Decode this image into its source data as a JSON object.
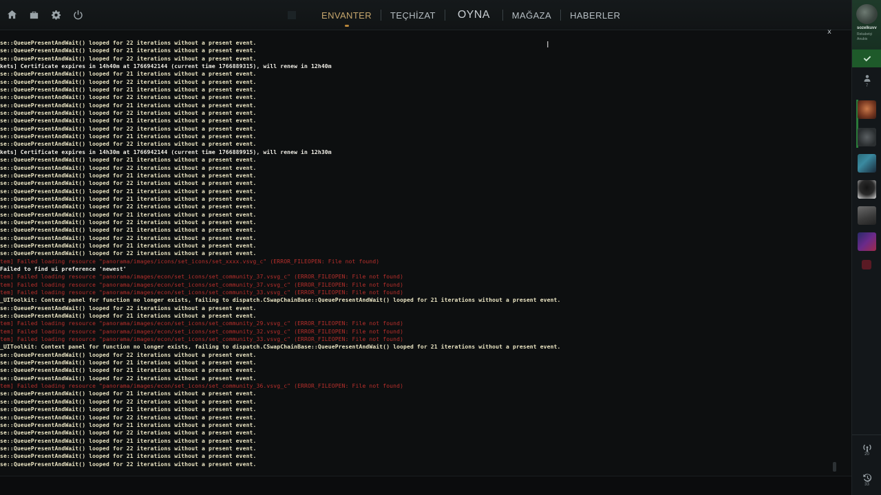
{
  "nav": {
    "items": [
      {
        "label": "ENVANTER",
        "active": true
      },
      {
        "label": "TEÇHİZAT",
        "active": false
      },
      {
        "label": "OYNA",
        "active": false
      },
      {
        "label": "MAĞAZA",
        "active": false
      },
      {
        "label": "HABERLER",
        "active": false
      }
    ]
  },
  "system_icons": [
    "home-icon",
    "briefcase-icon",
    "gear-icon",
    "power-icon"
  ],
  "console": {
    "close_label": "x",
    "lines": [
      {
        "text": "se::QueuePresentAndWait() looped for 22 iterations without a present event.",
        "kind": "warn"
      },
      {
        "text": "se::QueuePresentAndWait() looped for 21 iterations without a present event.",
        "kind": "warn"
      },
      {
        "text": "se::QueuePresentAndWait() looped for 22 iterations without a present event.",
        "kind": "warn"
      },
      {
        "text": "kets] Certificate expires in 14h40m at 1766942144 (current time 1766889315), will renew in 12h40m",
        "kind": "info"
      },
      {
        "text": "se::QueuePresentAndWait() looped for 21 iterations without a present event.",
        "kind": "warn"
      },
      {
        "text": "se::QueuePresentAndWait() looped for 22 iterations without a present event.",
        "kind": "warn"
      },
      {
        "text": "se::QueuePresentAndWait() looped for 21 iterations without a present event.",
        "kind": "warn"
      },
      {
        "text": "se::QueuePresentAndWait() looped for 22 iterations without a present event.",
        "kind": "warn"
      },
      {
        "text": "se::QueuePresentAndWait() looped for 21 iterations without a present event.",
        "kind": "warn"
      },
      {
        "text": "se::QueuePresentAndWait() looped for 22 iterations without a present event.",
        "kind": "warn"
      },
      {
        "text": "se::QueuePresentAndWait() looped for 21 iterations without a present event.",
        "kind": "warn"
      },
      {
        "text": "se::QueuePresentAndWait() looped for 22 iterations without a present event.",
        "kind": "warn"
      },
      {
        "text": "se::QueuePresentAndWait() looped for 21 iterations without a present event.",
        "kind": "warn"
      },
      {
        "text": "se::QueuePresentAndWait() looped for 22 iterations without a present event.",
        "kind": "warn"
      },
      {
        "text": "kets] Certificate expires in 14h30m at 1766942144 (current time 1766889915), will renew in 12h30m",
        "kind": "info"
      },
      {
        "text": "se::QueuePresentAndWait() looped for 21 iterations without a present event.",
        "kind": "warn"
      },
      {
        "text": "se::QueuePresentAndWait() looped for 22 iterations without a present event.",
        "kind": "warn"
      },
      {
        "text": "se::QueuePresentAndWait() looped for 21 iterations without a present event.",
        "kind": "warn"
      },
      {
        "text": "se::QueuePresentAndWait() looped for 22 iterations without a present event.",
        "kind": "warn"
      },
      {
        "text": "se::QueuePresentAndWait() looped for 21 iterations without a present event.",
        "kind": "warn"
      },
      {
        "text": "se::QueuePresentAndWait() looped for 21 iterations without a present event.",
        "kind": "warn"
      },
      {
        "text": "se::QueuePresentAndWait() looped for 22 iterations without a present event.",
        "kind": "warn"
      },
      {
        "text": "se::QueuePresentAndWait() looped for 21 iterations without a present event.",
        "kind": "warn"
      },
      {
        "text": "se::QueuePresentAndWait() looped for 22 iterations without a present event.",
        "kind": "warn"
      },
      {
        "text": "se::QueuePresentAndWait() looped for 21 iterations without a present event.",
        "kind": "warn"
      },
      {
        "text": "se::QueuePresentAndWait() looped for 22 iterations without a present event.",
        "kind": "warn"
      },
      {
        "text": "se::QueuePresentAndWait() looped for 21 iterations without a present event.",
        "kind": "warn"
      },
      {
        "text": "se::QueuePresentAndWait() looped for 22 iterations without a present event.",
        "kind": "warn"
      },
      {
        "text": "tem] Failed loading resource \"panorama/images/icons/set_icons/set_xxxx.vsvg_c\" (ERROR_FILEOPEN: File not found)",
        "kind": "error"
      },
      {
        "text": "Failed to find ui preference 'newest'",
        "kind": "info"
      },
      {
        "text": "tem] Failed loading resource \"panorama/images/econ/set_icons/set_community_37.vsvg_c\" (ERROR_FILEOPEN: File not found)",
        "kind": "error"
      },
      {
        "text": "tem] Failed loading resource \"panorama/images/econ/set_icons/set_community_37.vsvg_c\" (ERROR_FILEOPEN: File not found)",
        "kind": "error"
      },
      {
        "text": "tem] Failed loading resource \"panorama/images/econ/set_icons/set_community_33.vsvg_c\" (ERROR_FILEOPEN: File not found)",
        "kind": "error"
      },
      {
        "text": "_UIToolkit: Context panel for function no longer exists, failing to dispatch.CSwapChainBase::QueuePresentAndWait() looped for 21 iterations without a present event.",
        "kind": "warn"
      },
      {
        "text": "se::QueuePresentAndWait() looped for 22 iterations without a present event.",
        "kind": "warn"
      },
      {
        "text": "se::QueuePresentAndWait() looped for 21 iterations without a present event.",
        "kind": "warn"
      },
      {
        "text": "tem] Failed loading resource \"panorama/images/econ/set_icons/set_community_29.vsvg_c\" (ERROR_FILEOPEN: File not found)",
        "kind": "error"
      },
      {
        "text": "tem] Failed loading resource \"panorama/images/econ/set_icons/set_community_32.vsvg_c\" (ERROR_FILEOPEN: File not found)",
        "kind": "error"
      },
      {
        "text": "tem] Failed loading resource \"panorama/images/econ/set_icons/set_community_33.vsvg_c\" (ERROR_FILEOPEN: File not found)",
        "kind": "error"
      },
      {
        "text": "_UIToolkit: Context panel for function no longer exists, failing to dispatch.CSwapChainBase::QueuePresentAndWait() looped for 21 iterations without a present event.",
        "kind": "warn"
      },
      {
        "text": "se::QueuePresentAndWait() looped for 22 iterations without a present event.",
        "kind": "warn"
      },
      {
        "text": "se::QueuePresentAndWait() looped for 21 iterations without a present event.",
        "kind": "warn"
      },
      {
        "text": "se::QueuePresentAndWait() looped for 21 iterations without a present event.",
        "kind": "warn"
      },
      {
        "text": "se::QueuePresentAndWait() looped for 22 iterations without a present event.",
        "kind": "warn"
      },
      {
        "text": "tem] Failed loading resource \"panorama/images/econ/set_icons/set_community_36.vsvg_c\" (ERROR_FILEOPEN: File not found)",
        "kind": "error"
      },
      {
        "text": "se::QueuePresentAndWait() looped for 21 iterations without a present event.",
        "kind": "warn"
      },
      {
        "text": "se::QueuePresentAndWait() looped for 22 iterations without a present event.",
        "kind": "warn"
      },
      {
        "text": "se::QueuePresentAndWait() looped for 21 iterations without a present event.",
        "kind": "warn"
      },
      {
        "text": "se::QueuePresentAndWait() looped for 22 iterations without a present event.",
        "kind": "warn"
      },
      {
        "text": "se::QueuePresentAndWait() looped for 21 iterations without a present event.",
        "kind": "warn"
      },
      {
        "text": "se::QueuePresentAndWait() looped for 22 iterations without a present event.",
        "kind": "warn"
      },
      {
        "text": "se::QueuePresentAndWait() looped for 21 iterations without a present event.",
        "kind": "warn"
      },
      {
        "text": "se::QueuePresentAndWait() looped for 22 iterations without a present event.",
        "kind": "warn"
      },
      {
        "text": "se::QueuePresentAndWait() looped for 21 iterations without a present event.",
        "kind": "warn"
      },
      {
        "text": "se::QueuePresentAndWait() looped for 22 iterations without a present event.",
        "kind": "warn"
      }
    ]
  },
  "sidebar": {
    "profile": {
      "name": "sozelkuvv",
      "status": "Rekabetçi Anubis"
    },
    "friends_count": "7",
    "signal_count": "20",
    "history_count": "33"
  },
  "colors": {
    "accent": "#c7a76d",
    "warn_text": "#ece6c4",
    "error_text": "#c9322e",
    "ready_green": "#1e5a2a"
  }
}
